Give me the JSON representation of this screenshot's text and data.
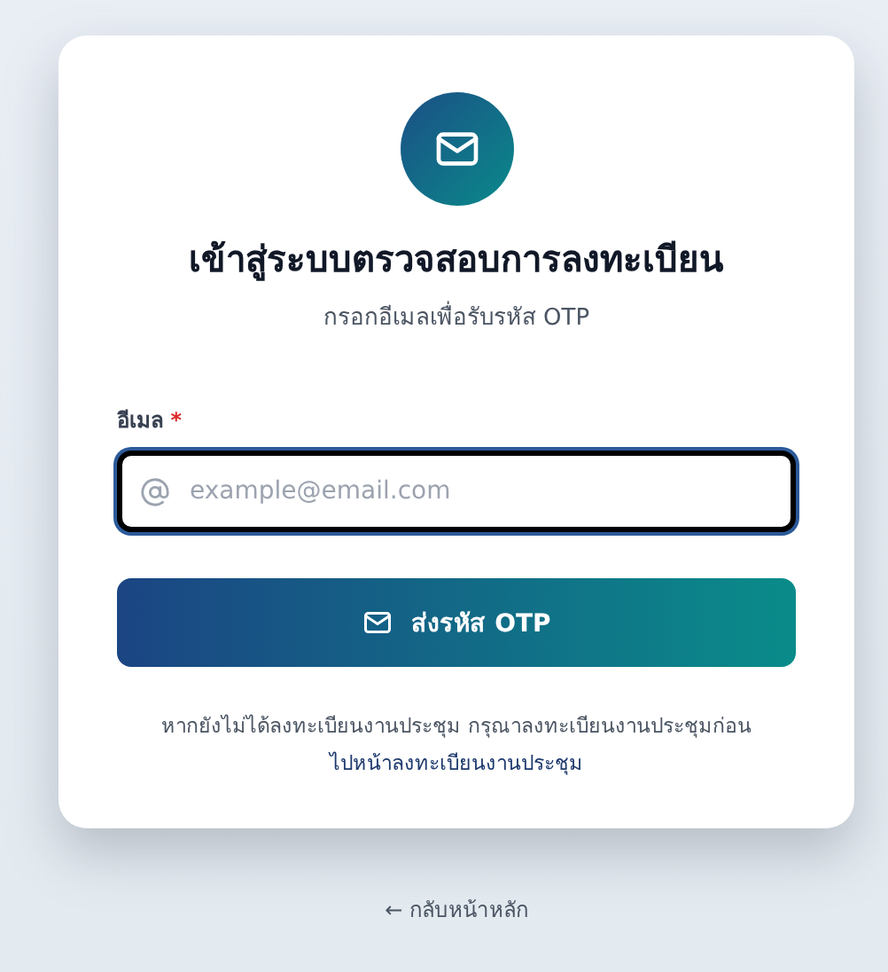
{
  "title": "เข้าสู่ระบบตรวจสอบการลงทะเบียน",
  "subtitle": "กรอกอีเมลเพื่อรับรหัส OTP",
  "email_field": {
    "label": "อีเมล",
    "required": true,
    "required_mark": "*",
    "placeholder": "example@email.com",
    "focused": true
  },
  "send_button": {
    "label": "ส่งรหัส OTP"
  },
  "note": "หากยังไม่ได้ลงทะเบียนงานประชุม กรุณาลงทะเบียนงานประชุมก่อน",
  "register_link": "ไปหน้าลงทะเบียนงานประชุม",
  "back_link": "← กลับหน้าหลัก"
}
